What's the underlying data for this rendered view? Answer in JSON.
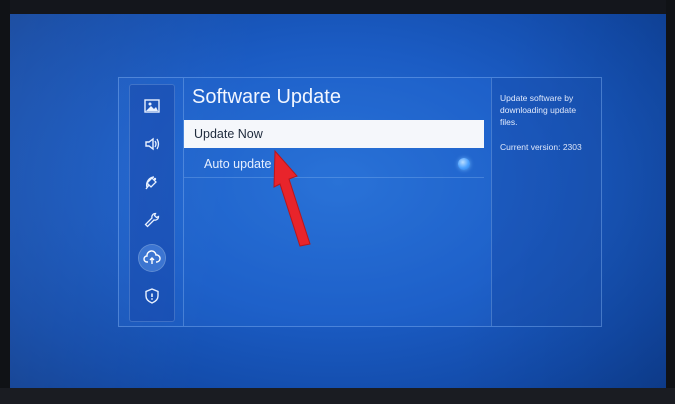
{
  "menu": {
    "title": "Software Update",
    "items": [
      {
        "label": "Update Now",
        "selected": true
      },
      {
        "label": "Auto update",
        "toggle": "on"
      }
    ]
  },
  "info": {
    "description": "Update software by downloading update files.",
    "version": "Current version: 2303"
  },
  "sidebar": {
    "icons": [
      "picture-icon",
      "sound-icon",
      "broadcasting-icon",
      "general-settings-icon",
      "support-icon",
      "privacy-icon"
    ],
    "active_index": 4
  },
  "annotation": {
    "arrow_color": "#e8242b"
  },
  "colors": {
    "screen_blue": "#1b5cc4",
    "selection": "#f5f7fb",
    "toggle": "#4aa0ff"
  }
}
